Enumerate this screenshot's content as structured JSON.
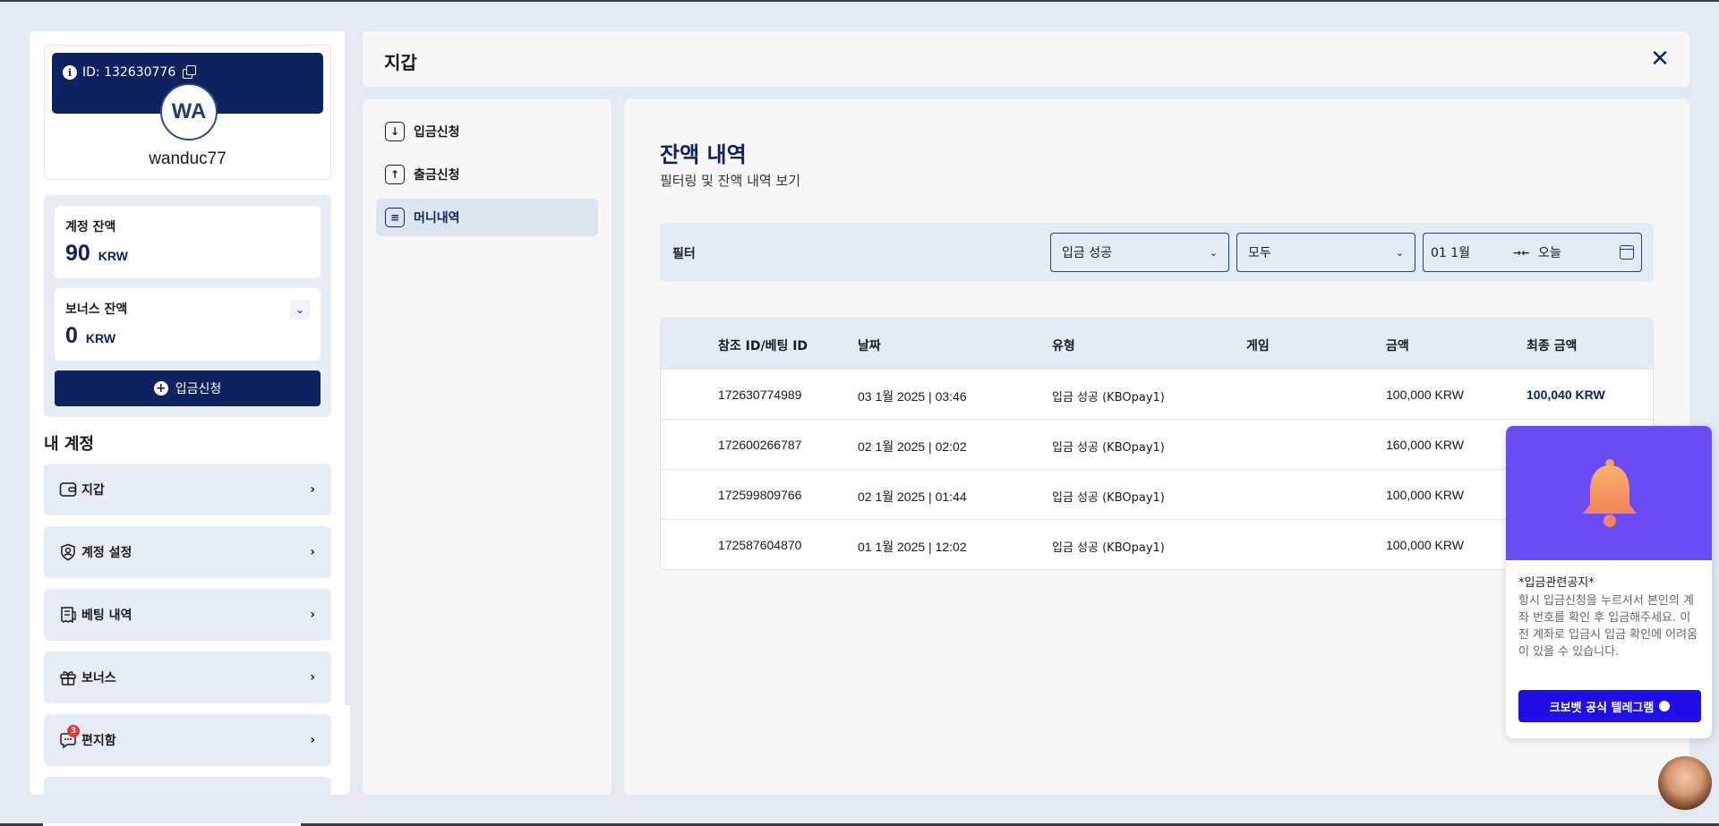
{
  "sidebar": {
    "user_id": "ID: 132630776",
    "avatar_initials": "WA",
    "username": "wanduc77",
    "account_balance_label": "계정 잔액",
    "account_balance_value": "90",
    "account_balance_currency": "KRW",
    "bonus_balance_label": "보너스 잔액",
    "bonus_balance_value": "0",
    "bonus_balance_currency": "KRW",
    "deposit_button": "입금신청",
    "my_account_title": "내 계정",
    "menu": [
      {
        "label": "지갑",
        "icon": "wallet-icon"
      },
      {
        "label": "계정 설정",
        "icon": "user-settings-icon"
      },
      {
        "label": "베팅 내역",
        "icon": "receipt-icon"
      },
      {
        "label": "보너스",
        "icon": "gift-icon"
      },
      {
        "label": "편지함",
        "icon": "chat-icon",
        "badge": "3"
      }
    ]
  },
  "header": {
    "title": "지갑",
    "close_icon": "close-icon"
  },
  "subnav": {
    "items": [
      {
        "label": "입금신청",
        "icon": "download-icon",
        "active": false
      },
      {
        "label": "출금신청",
        "icon": "upload-icon",
        "active": false
      },
      {
        "label": "머니내역",
        "icon": "document-icon",
        "active": true
      }
    ]
  },
  "main": {
    "title": "잔액 내역",
    "subtitle": "필터링 및 잔액 내역 보기",
    "filter": {
      "label": "필터",
      "type_select": "입금 성공",
      "game_select": "모두",
      "date_from": "01 1월",
      "date_to": "오늘"
    },
    "table": {
      "columns": [
        "참조 ID/베팅 ID",
        "날짜",
        "유형",
        "게임",
        "금액",
        "최종 금액"
      ],
      "rows": [
        {
          "ref": "172630774989",
          "date": "03 1월 2025 | 03:46",
          "type": "입금 성공 (KBOpay1)",
          "game": "",
          "amount": "100,000 KRW",
          "final": "100,040 KRW"
        },
        {
          "ref": "172600266787",
          "date": "02 1월 2025 | 02:02",
          "type": "입금 성공 (KBOpay1)",
          "game": "",
          "amount": "160,000 KRW",
          "final": ""
        },
        {
          "ref": "172599809766",
          "date": "02 1월 2025 | 01:44",
          "type": "입금 성공 (KBOpay1)",
          "game": "",
          "amount": "100,000 KRW",
          "final": ""
        },
        {
          "ref": "172587604870",
          "date": "01 1월 2025 | 12:02",
          "type": "입금 성공 (KBOpay1)",
          "game": "",
          "amount": "100,000 KRW",
          "final": ""
        }
      ]
    }
  },
  "notice": {
    "title": "*입금관련공지*",
    "body": "항시 입금신청을 누르셔서 본인의 계좌 번호를 확인 후 입금해주세요. 이전 계좌로 입금시 입금 확인에 어려움이 있을 수 있습니다.",
    "button": "크보벳 공식 텔레그램"
  },
  "colors": {
    "navy": "#0f2260",
    "panel": "#e3ebf4",
    "notice_header": "#6c4af4",
    "notice_button": "#1f0fe6"
  }
}
